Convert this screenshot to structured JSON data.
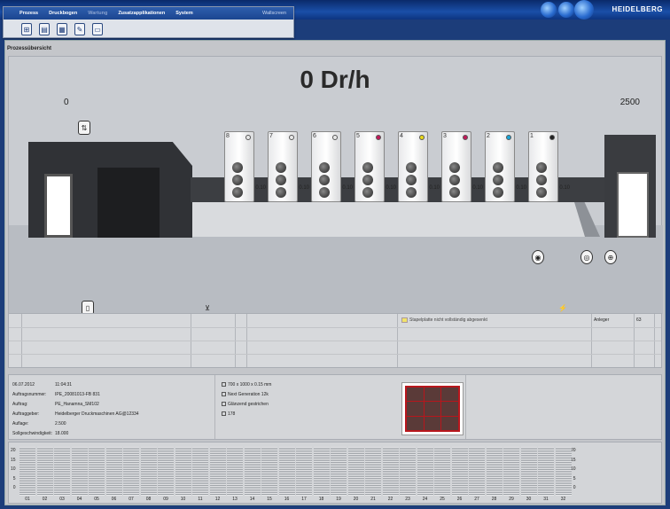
{
  "app": {
    "brand": "HEIDELBERG"
  },
  "menu": {
    "items": [
      {
        "label": "Prozess",
        "enabled": true
      },
      {
        "label": "Druckbogen",
        "enabled": true
      },
      {
        "label": "Wartung",
        "enabled": false
      },
      {
        "label": "Zusatzapplikationen",
        "enabled": true
      },
      {
        "label": "System",
        "enabled": true
      }
    ],
    "workspace": "Wallscreen",
    "toolbar_icons": [
      "press-overview-icon",
      "sheet-icon",
      "document-icon",
      "edit-job-icon",
      "monitor-icon"
    ]
  },
  "view": {
    "title": "Prozessübersicht"
  },
  "machine": {
    "speed": "0 Dr/h",
    "speed_min": "0",
    "speed_max": "2500",
    "units": [
      {
        "num": "8",
        "value": "0.10",
        "ink": "#e8e8e8"
      },
      {
        "num": "7",
        "value": "0.10",
        "ink": "#e8e8e8"
      },
      {
        "num": "6",
        "value": "0.10",
        "ink": "#e8e8e8"
      },
      {
        "num": "5",
        "value": "0.10",
        "ink": "#c21a5a"
      },
      {
        "num": "4",
        "value": "0.10",
        "ink": "#e8d81a"
      },
      {
        "num": "3",
        "value": "0.10",
        "ink": "#c21a5a"
      },
      {
        "num": "2",
        "value": "0.10",
        "ink": "#1aa5d8"
      },
      {
        "num": "1",
        "value": "0.10",
        "ink": "#222222"
      }
    ]
  },
  "messages": {
    "text": "Stapelplatte nicht vollständig abgesenkt",
    "source": "Anleger",
    "code": "63"
  },
  "job": {
    "date": "06.07.2012",
    "time": "11:04:31",
    "fields": [
      {
        "label": "Auftragsnummer:",
        "value": "IPE_20081013-FB 831"
      },
      {
        "label": "Auftrag:",
        "value": "PE_Hanamna_SM102"
      },
      {
        "label": "Auftraggeber:",
        "value": "Heidelberger Druckmaschinen AG@12334"
      },
      {
        "label": "Auflage:",
        "value": "2.500"
      },
      {
        "label": "Sollgeschwindigkeit:",
        "value": "18.000"
      }
    ],
    "format": [
      "700 x 1000 x 0.15 mm",
      "Next Generation 12k",
      "Glänzend gestrichen",
      "178"
    ]
  },
  "ink_zones": {
    "scale_left": [
      "20",
      "15",
      "10",
      "5",
      "0"
    ],
    "scale_right": [
      "20",
      "15",
      "10",
      "5",
      "0"
    ],
    "zones": [
      "01",
      "02",
      "03",
      "04",
      "05",
      "06",
      "07",
      "08",
      "09",
      "10",
      "11",
      "12",
      "13",
      "14",
      "15",
      "16",
      "17",
      "18",
      "19",
      "20",
      "21",
      "22",
      "23",
      "24",
      "25",
      "26",
      "27",
      "28",
      "29",
      "30",
      "31",
      "32"
    ]
  }
}
